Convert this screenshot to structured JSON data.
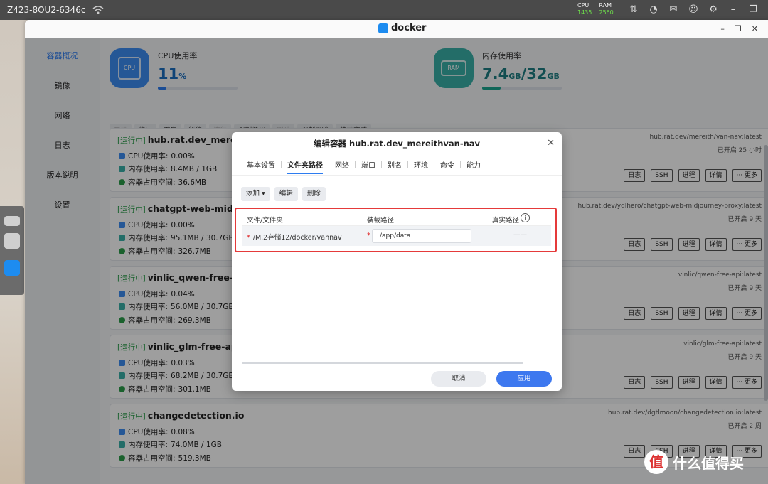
{
  "system": {
    "hostname": "Z423-8OU2-6346c",
    "cpu_label": "CPU",
    "ram_label": "RAM",
    "cpu_val": "1435",
    "ram_val": "2560",
    "icons": [
      "transfer-icon",
      "gauge-icon",
      "mail-icon",
      "user-icon",
      "settings-icon",
      "minimize-icon",
      "window-icon"
    ]
  },
  "window": {
    "title": "docker"
  },
  "sidebar": {
    "items": [
      "容器概况",
      "镜像",
      "网络",
      "日志",
      "版本说明",
      "设置"
    ]
  },
  "resources": {
    "cpu": {
      "label": "CPU使用率",
      "value": "11",
      "unit": "%",
      "chip": "CPU",
      "percent": 11
    },
    "mem": {
      "label": "内存使用率",
      "used": "7.4",
      "used_unit": "GB",
      "sep": "/",
      "total": "32",
      "total_unit": "GB",
      "chip": "RAM",
      "percent": 23
    }
  },
  "actions": [
    "启动",
    "停止",
    "重启",
    "暂停",
    "恢复",
    "强制关闭",
    "删除",
    "强制删除",
    "快捷方式"
  ],
  "status_running": "[运行中]",
  "card_labels": {
    "cpu": "CPU使用率: ",
    "mem": "内存使用率: ",
    "disk": "容器占用空间: "
  },
  "card_buttons": [
    "日志",
    "SSH",
    "进程",
    "详情",
    "··· 更多"
  ],
  "containers": [
    {
      "name": "hub.rat.dev_mereithv",
      "cpu": "0.00%",
      "mem": "8.4MB / 1GB",
      "disk": "36.6MB",
      "image": "hub.rat.dev/mereith/van-nav:latest",
      "uptime": "已开启 25 小时"
    },
    {
      "name": "chatgpt-web-midjour",
      "cpu": "0.00%",
      "mem": "95.1MB / 30.7GB",
      "disk": "326.7MB",
      "image": "hub.rat.dev/ydlhero/chatgpt-web-midjourney-proxy:latest",
      "uptime": "已开启 9 天"
    },
    {
      "name": "vinlic_qwen-free-api",
      "cpu": "0.04%",
      "mem": "56.0MB / 30.7GB",
      "disk": "269.3MB",
      "image": "vinlic/qwen-free-api:latest",
      "uptime": "已开启 9 天"
    },
    {
      "name": "vinlic_glm-free-api",
      "cpu": "0.03%",
      "mem": "68.2MB / 30.7GB",
      "disk": "301.1MB",
      "image": "vinlic/glm-free-api:latest",
      "uptime": "已开启 9 天"
    },
    {
      "name": "changedetection.io",
      "cpu": "0.08%",
      "mem": "74.0MB / 1GB",
      "disk": "519.3MB",
      "image": "hub.rat.dev/dgtlmoon/changedetection.io:latest",
      "uptime": "已开启 2 周"
    }
  ],
  "dialog": {
    "title": "编辑容器 hub.rat.dev_mereithvan-nav",
    "tabs": [
      "基本设置",
      "文件夹路径",
      "网络",
      "端口",
      "别名",
      "环境",
      "命令",
      "能力"
    ],
    "active_tab": 1,
    "tools": {
      "add": "添加 ▾",
      "edit": "编辑",
      "delete": "删除"
    },
    "columns": {
      "host": "文件/文件夹",
      "mount": "装载路径",
      "real": "真实路径"
    },
    "row": {
      "star": "*",
      "host": "/M.2存储12/docker/vannav",
      "mount": "/app/data",
      "real": "——"
    },
    "cancel": "取消",
    "apply": "应用"
  },
  "watermark": {
    "logo": "值",
    "text": "什么值得买"
  }
}
